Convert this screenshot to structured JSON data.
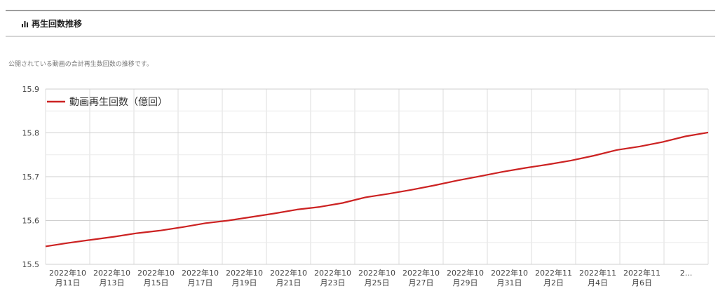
{
  "header": {
    "title": "再生回数推移",
    "icon": "bar-chart-icon"
  },
  "description": "公開されている動画の合計再生数回数の推移です。",
  "chart_data": {
    "type": "line",
    "ylim": [
      15.5,
      15.9
    ],
    "yticks": [
      "15.5",
      "15.6",
      "15.7",
      "15.8",
      "15.9"
    ],
    "grid": true,
    "legend_position": "top-left",
    "categories": [
      [
        "2022年10",
        "月11日"
      ],
      [
        "2022年10",
        "月13日"
      ],
      [
        "2022年10",
        "月15日"
      ],
      [
        "2022年10",
        "月17日"
      ],
      [
        "2022年10",
        "月19日"
      ],
      [
        "2022年10",
        "月21日"
      ],
      [
        "2022年10",
        "月23日"
      ],
      [
        "2022年10",
        "月25日"
      ],
      [
        "2022年10",
        "月27日"
      ],
      [
        "2022年10",
        "月29日"
      ],
      [
        "2022年10",
        "月31日"
      ],
      [
        "2022年11",
        "月2日"
      ],
      [
        "2022年11",
        "月4日"
      ],
      [
        "2022年11",
        "月6日"
      ],
      [
        "2...",
        ""
      ]
    ],
    "series": [
      {
        "name": "動画再生回数（億回）",
        "color": "#cc2222",
        "values": [
          15.541,
          15.549,
          15.556,
          15.563,
          15.571,
          15.577,
          15.585,
          15.594,
          15.6,
          15.608,
          15.616,
          15.625,
          15.631,
          15.64,
          15.653,
          15.661,
          15.67,
          15.68,
          15.691,
          15.701,
          15.711,
          15.72,
          15.728,
          15.737,
          15.748,
          15.761,
          15.769,
          15.779,
          15.792,
          15.801
        ]
      }
    ]
  }
}
